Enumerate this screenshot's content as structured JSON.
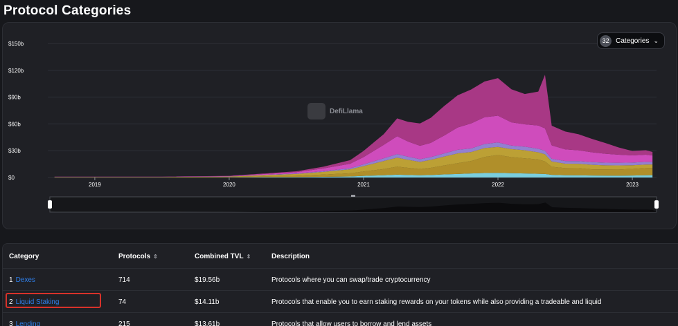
{
  "page": {
    "title": "Protocol Categories"
  },
  "chart_controls": {
    "count": "32",
    "label": "Categories",
    "chevron_icon": "chevron-down-icon"
  },
  "watermark": {
    "text": "DefiLlama",
    "icon": "defillama-logo-icon"
  },
  "chart_data": {
    "type": "area",
    "stacked": true,
    "title": "",
    "xlabel": "",
    "ylabel": "",
    "y_ticks": [
      "$0",
      "$30b",
      "$60b",
      "$90b",
      "$120b",
      "$150b"
    ],
    "x_ticks": [
      "2019",
      "2020",
      "2021",
      "2022",
      "2023"
    ],
    "ylim": [
      0,
      150
    ],
    "xlim": [
      2018.65,
      2023.18
    ],
    "grid": true,
    "x": [
      2018.7,
      2019.5,
      2020.0,
      2020.5,
      2020.7,
      2020.9,
      2021.0,
      2021.15,
      2021.25,
      2021.33,
      2021.42,
      2021.5,
      2021.6,
      2021.7,
      2021.8,
      2021.9,
      2022.0,
      2022.1,
      2022.2,
      2022.3,
      2022.35,
      2022.4,
      2022.5,
      2022.6,
      2022.7,
      2022.8,
      2022.9,
      2023.0,
      2023.1,
      2023.15
    ],
    "series": [
      {
        "color": "#7fd8e8",
        "values": [
          0.1,
          0.1,
          0.2,
          0.5,
          0.8,
          1.2,
          1.8,
          2.5,
          3.2,
          2.8,
          2.5,
          2.8,
          3.5,
          4,
          4.5,
          5,
          5.2,
          4.8,
          4.5,
          4.2,
          4,
          3,
          2.5,
          2.4,
          2.2,
          2.1,
          2.0,
          2.2,
          2.5,
          2.6
        ]
      },
      {
        "color": "#b8962a",
        "values": [
          0.2,
          0.2,
          0.4,
          1.5,
          2.5,
          3.5,
          5,
          7,
          9,
          8,
          7,
          8,
          10,
          12,
          14,
          18,
          20,
          18,
          17,
          16,
          14,
          9,
          8,
          8,
          7,
          7,
          7,
          7.5,
          8,
          8
        ]
      },
      {
        "color": "#c5a836",
        "values": [
          0.3,
          0.3,
          0.5,
          2,
          3,
          4.5,
          6,
          9,
          10,
          9,
          8,
          9,
          10,
          11,
          10,
          10,
          9,
          9,
          9,
          8,
          8,
          6,
          5,
          5,
          5,
          4.5,
          4.5,
          4,
          4,
          4
        ]
      },
      {
        "color": "#9a86d9",
        "values": [
          0.1,
          0.1,
          0.1,
          0.5,
          0.8,
          1.2,
          2,
          3,
          4,
          3.5,
          3,
          3,
          3.5,
          4,
          4,
          4.5,
          5,
          4,
          4,
          4,
          4,
          3,
          3,
          3,
          3,
          3,
          3,
          3,
          3,
          3
        ]
      },
      {
        "color": "#d94fc4",
        "values": [
          0.2,
          0.2,
          0.4,
          1.5,
          3,
          5,
          8,
          15,
          20,
          17,
          15,
          16,
          20,
          25,
          28,
          30,
          30,
          26,
          25,
          26,
          25,
          15,
          13,
          12,
          11,
          10,
          9,
          8,
          8,
          7
        ]
      },
      {
        "color": "#b03a8a",
        "values": [
          0.1,
          0.1,
          0.2,
          1,
          2,
          4,
          7,
          12,
          20,
          22,
          25,
          28,
          33,
          36,
          38,
          40,
          42,
          37,
          34,
          38,
          60,
          22,
          20,
          18,
          15,
          12,
          8,
          5,
          5,
          4
        ]
      }
    ]
  },
  "table": {
    "headers": {
      "category": "Category",
      "protocols": "Protocols",
      "tvl": "Combined TVL",
      "description": "Description"
    },
    "sort_icon": "sort-icon",
    "rows": [
      {
        "rank": "1",
        "name": "Dexes",
        "protocols": "714",
        "tvl": "$19.56b",
        "description": "Protocols where you can swap/trade cryptocurrency"
      },
      {
        "rank": "2",
        "name": "Liquid Staking",
        "protocols": "74",
        "tvl": "$14.11b",
        "description": "Protocols that enable you to earn staking rewards on your tokens while also providing a tradeable and liquid"
      },
      {
        "rank": "3",
        "name": "Lending",
        "protocols": "215",
        "tvl": "$13.61b",
        "description": "Protocols that allow users to borrow and lend assets"
      }
    ]
  },
  "highlight": {
    "row": 1,
    "color": "#d8322a"
  }
}
